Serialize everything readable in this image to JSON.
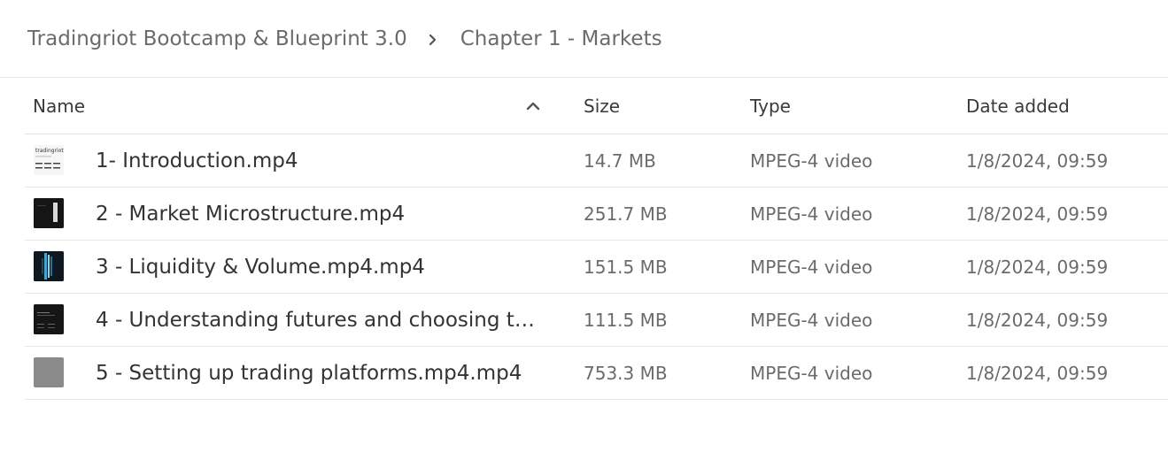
{
  "breadcrumb": {
    "parent": "Tradingriot Bootcamp & Blueprint 3.0",
    "current": "Chapter 1 - Markets"
  },
  "columns": {
    "name": "Name",
    "size": "Size",
    "type": "Type",
    "date": "Date added",
    "sort_icon": "chevron-up-icon"
  },
  "files": [
    {
      "name": "1- Introduction.mp4",
      "size": "14.7 MB",
      "type": "MPEG-4 video",
      "date": "1/8/2024, 09:59",
      "thumb_text": "tradingriot"
    },
    {
      "name": "2 - Market Microstructure.mp4",
      "size": "251.7 MB",
      "type": "MPEG-4 video",
      "date": "1/8/2024, 09:59"
    },
    {
      "name": "3 - Liquidity & Volume.mp4.mp4",
      "size": "151.5 MB",
      "type": "MPEG-4 video",
      "date": "1/8/2024, 09:59"
    },
    {
      "name": "4 - Understanding futures and choosing th…",
      "size": "111.5 MB",
      "type": "MPEG-4 video",
      "date": "1/8/2024, 09:59"
    },
    {
      "name": "5 - Setting up trading platforms.mp4.mp4",
      "size": "753.3 MB",
      "type": "MPEG-4 video",
      "date": "1/8/2024, 09:59"
    }
  ],
  "colors": {
    "text": "#333333",
    "muted": "#6b6b6b",
    "divider": "#e6e6e6"
  }
}
